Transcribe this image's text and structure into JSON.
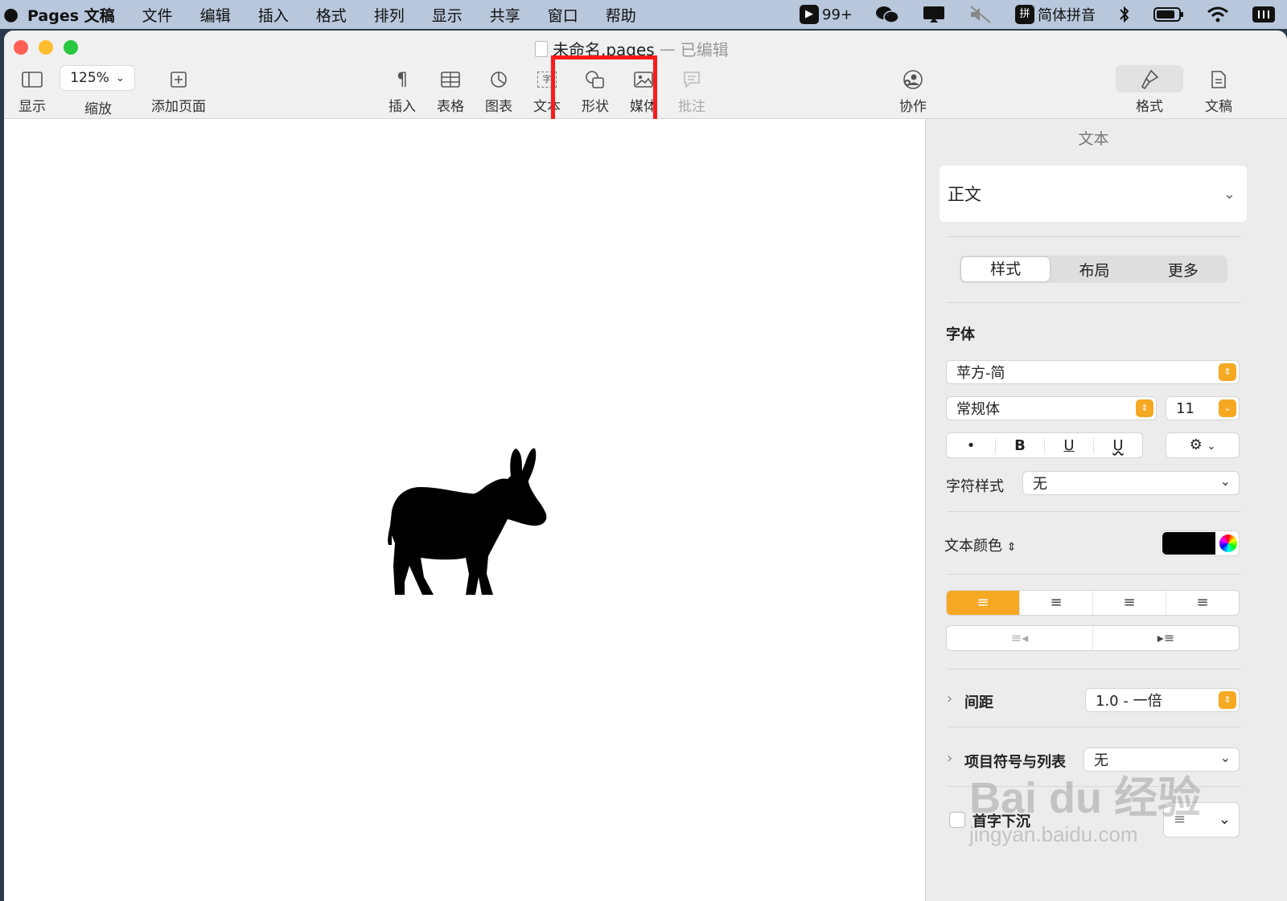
{
  "menubar": {
    "apple": "",
    "app_name": "Pages 文稿",
    "items": [
      "文件",
      "编辑",
      "插入",
      "格式",
      "排列",
      "显示",
      "共享",
      "窗口",
      "帮助"
    ],
    "status": {
      "notification_count": "99+",
      "input_method_badge": "拼",
      "input_method": "简体拼音"
    }
  },
  "window": {
    "title": "未命名.pages",
    "title_separator": "—",
    "title_state": "已编辑"
  },
  "toolbar": {
    "view_label": "显示",
    "zoom_value": "125%",
    "zoom_label": "缩放",
    "add_page_label": "添加页面",
    "insert_label": "插入",
    "table_label": "表格",
    "chart_label": "图表",
    "text_label": "文本",
    "text_icon_char": "字",
    "shape_label": "形状",
    "media_label": "媒体",
    "comment_label": "批注",
    "collaborate_label": "协作",
    "format_label": "格式",
    "document_label": "文稿"
  },
  "sidebar": {
    "title": "文本",
    "paragraph_style": "正文",
    "tabs": [
      "样式",
      "布局",
      "更多"
    ],
    "font_section": "字体",
    "font_family": "苹方-简",
    "font_weight": "常规体",
    "font_size": "11",
    "style_buttons": [
      "•",
      "B",
      "U",
      "U"
    ],
    "char_style_label": "字符样式",
    "char_style_value": "无",
    "text_color_label": "文本颜色",
    "text_color": "#000000",
    "spacing_label": "间距",
    "spacing_value": "1.0 - 一倍",
    "bullets_label": "项目符号与列表",
    "bullets_value": "无",
    "dropcap_label": "首字下沉",
    "accent_color": "#f7a823"
  },
  "watermark": {
    "brand": "Bai  du 经验",
    "url": "jingyan.baidu.com"
  }
}
